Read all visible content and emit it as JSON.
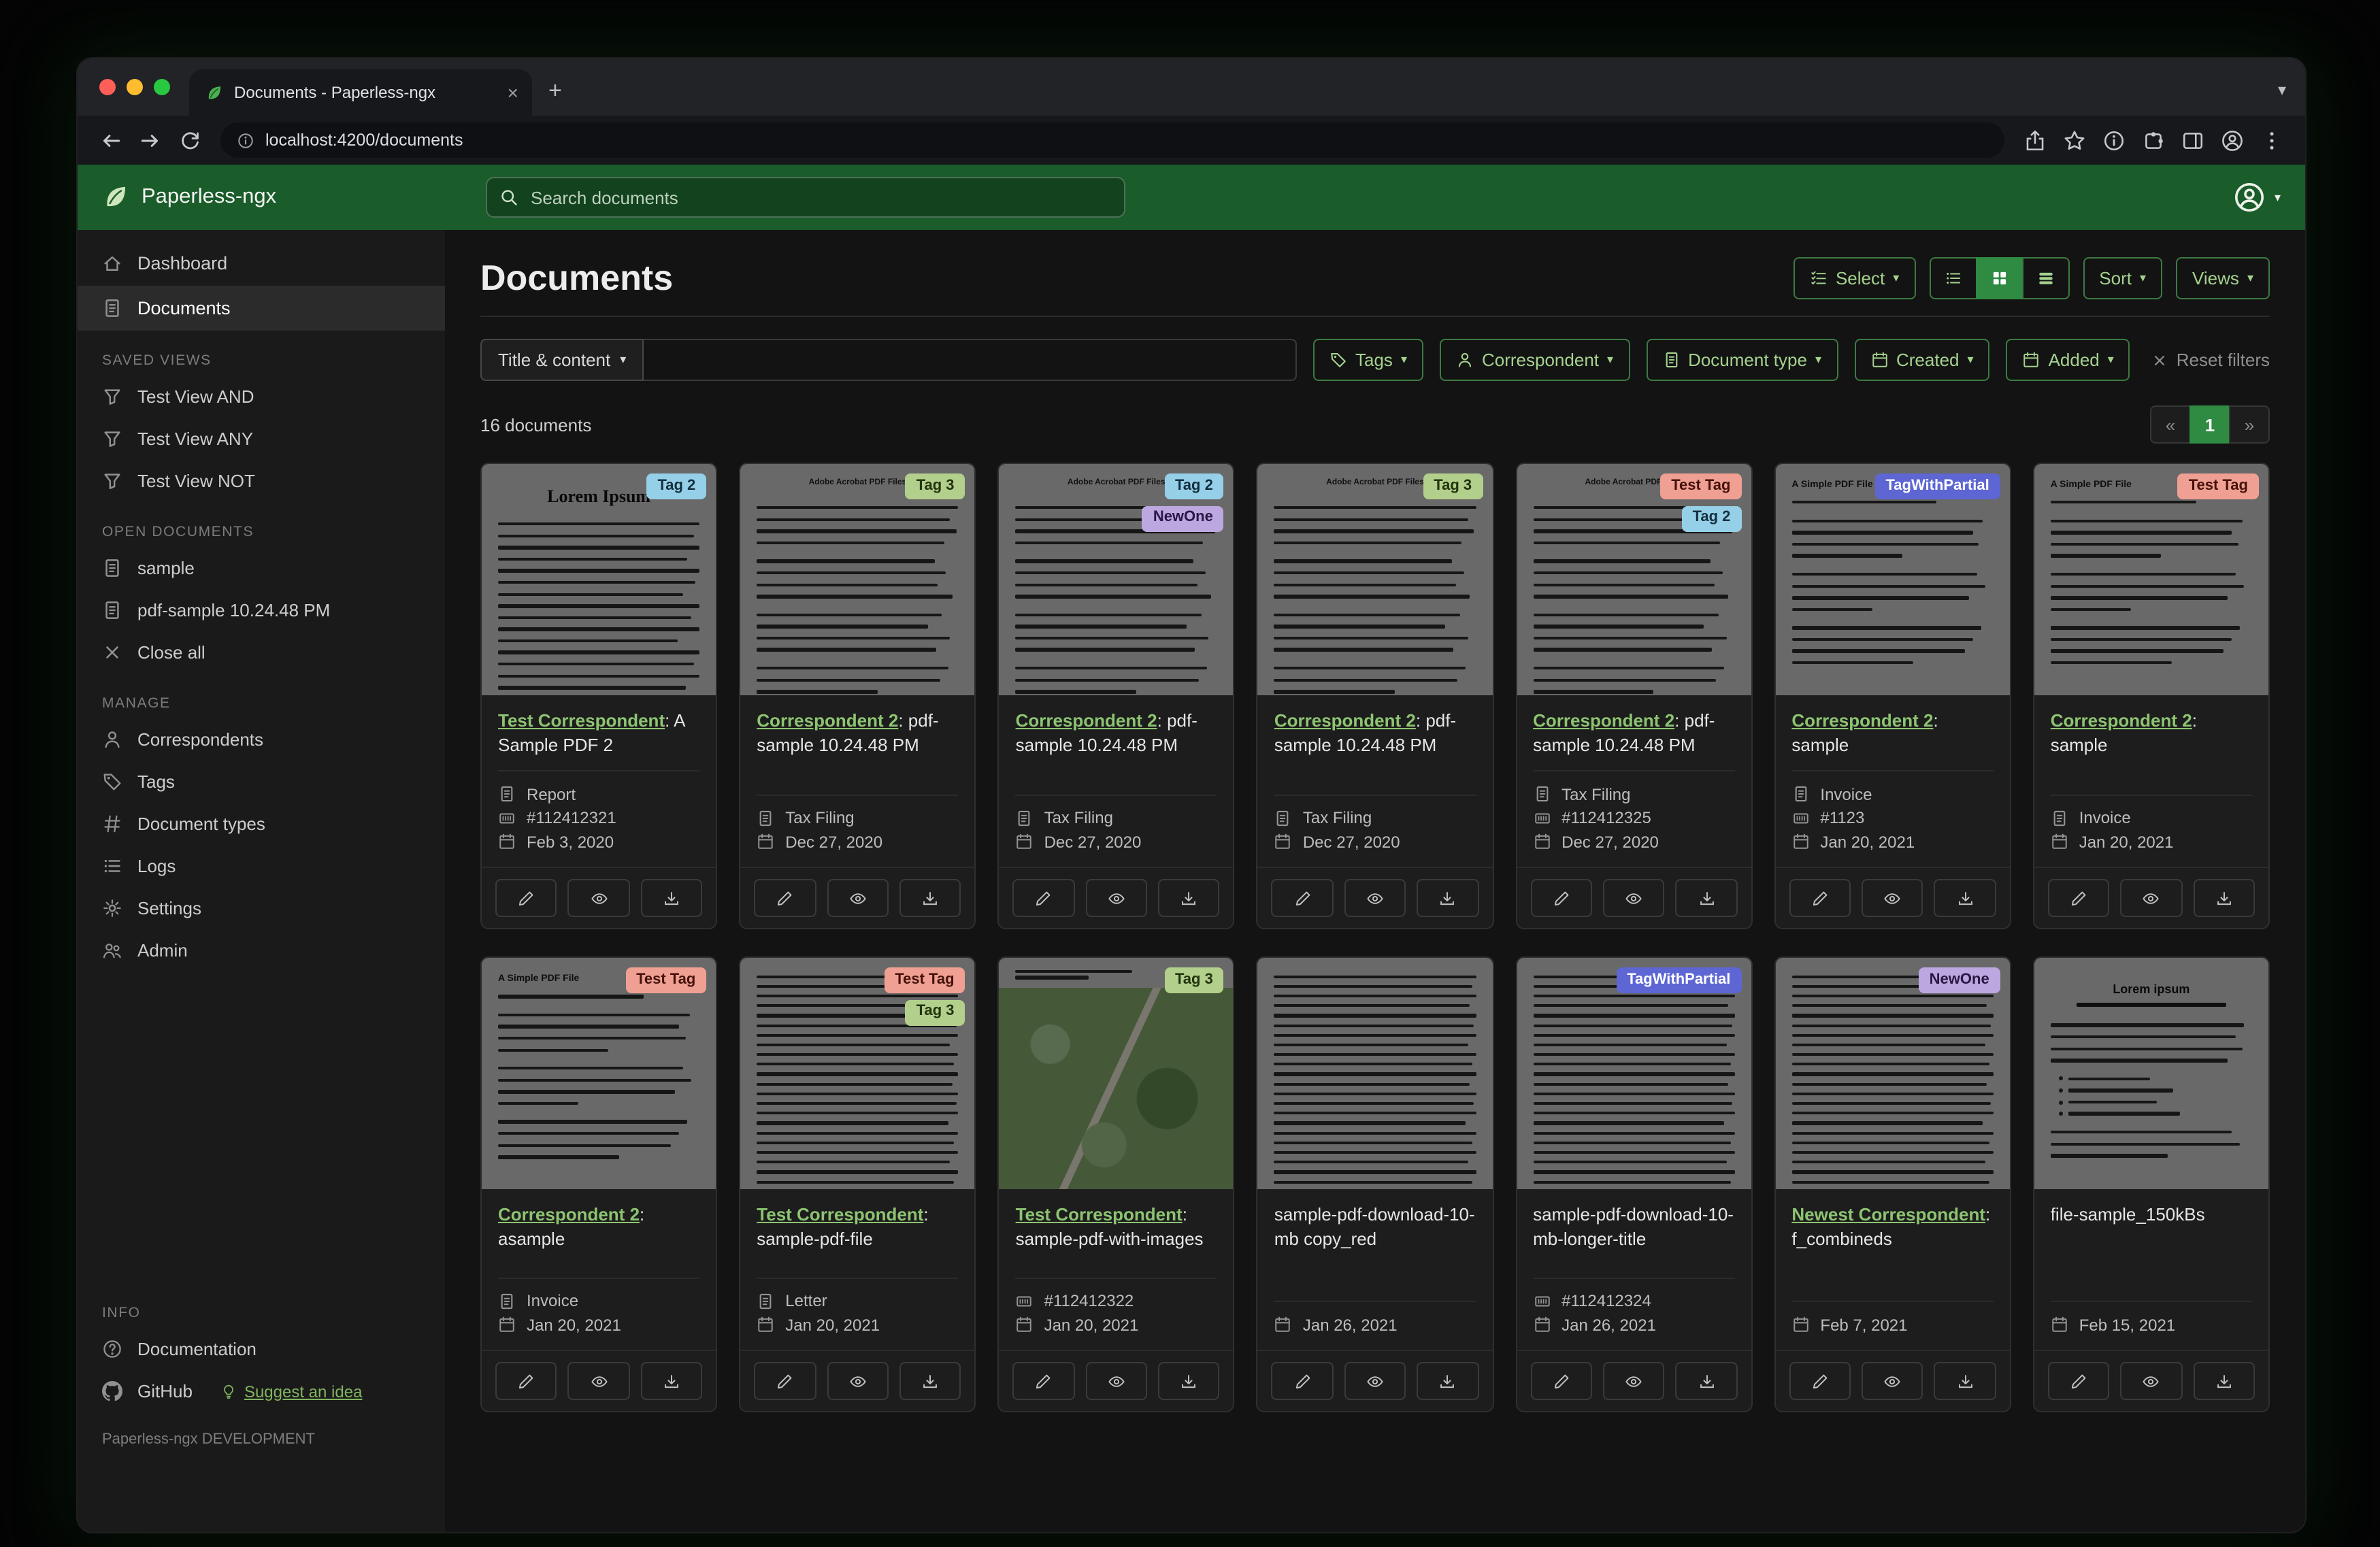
{
  "browser": {
    "tab_title": "Documents - Paperless-ngx",
    "new_tab_label": "+",
    "url": "localhost:4200/documents"
  },
  "header": {
    "brand": "Paperless-ngx",
    "search_placeholder": "Search documents"
  },
  "sidebar": {
    "primary": [
      {
        "label": "Dashboard",
        "icon": "home",
        "active": false
      },
      {
        "label": "Documents",
        "icon": "file",
        "active": true
      }
    ],
    "sections": [
      {
        "title": "SAVED VIEWS",
        "items": [
          {
            "label": "Test View AND",
            "icon": "funnel"
          },
          {
            "label": "Test View ANY",
            "icon": "funnel"
          },
          {
            "label": "Test View NOT",
            "icon": "funnel"
          }
        ]
      },
      {
        "title": "OPEN DOCUMENTS",
        "items": [
          {
            "label": "sample",
            "icon": "file"
          },
          {
            "label": "pdf-sample 10.24.48 PM",
            "icon": "file"
          },
          {
            "label": "Close all",
            "icon": "x"
          }
        ]
      },
      {
        "title": "MANAGE",
        "items": [
          {
            "label": "Correspondents",
            "icon": "person"
          },
          {
            "label": "Tags",
            "icon": "tag"
          },
          {
            "label": "Document types",
            "icon": "hash"
          },
          {
            "label": "Logs",
            "icon": "list"
          },
          {
            "label": "Settings",
            "icon": "gear"
          },
          {
            "label": "Admin",
            "icon": "people"
          }
        ]
      },
      {
        "title": "INFO",
        "items": [
          {
            "label": "Documentation",
            "icon": "question"
          },
          {
            "label": "GitHub",
            "icon": "github",
            "extra": "Suggest an idea"
          }
        ]
      }
    ],
    "footer": "Paperless-ngx DEVELOPMENT"
  },
  "main": {
    "title": "Documents",
    "select_label": "Select",
    "sort_label": "Sort",
    "views_label": "Views",
    "count_text": "16 documents",
    "pagination": {
      "prev": "«",
      "page": "1",
      "next": "»"
    }
  },
  "filters": {
    "title_dropdown": "Title & content",
    "tags_label": "Tags",
    "correspondent_label": "Correspondent",
    "doctype_label": "Document type",
    "created_label": "Created",
    "added_label": "Added",
    "reset_label": "Reset filters"
  },
  "cards": {
    "separator": ": ",
    "actions": [
      {
        "name": "edit",
        "icon": "pencil"
      },
      {
        "name": "preview",
        "icon": "eye"
      },
      {
        "name": "download",
        "icon": "download"
      }
    ]
  },
  "tags": {
    "Tag 2": {
      "bg": "#96cfe8",
      "fg": "#14303f"
    },
    "Tag 3": {
      "bg": "#b2cf8b",
      "fg": "#23330f"
    },
    "NewOne": {
      "bg": "#bda7e0",
      "fg": "#2a1844"
    },
    "Test Tag": {
      "bg": "#efa093",
      "fg": "#45120b"
    },
    "TagWithPartial": {
      "bg": "#5d66d3",
      "fg": "#ffffff"
    }
  },
  "documents": [
    {
      "correspondent": "Test Correspondent",
      "title": "A Sample PDF 2",
      "doc_type": "Report",
      "asn": "#112412321",
      "date": "Feb 3, 2020",
      "tags": [
        "Tag 2"
      ],
      "thumb": "lorem",
      "thumb_heading": "Lorem Ipsum"
    },
    {
      "correspondent": "Correspondent 2",
      "title": "pdf-sample 10.24.48 PM",
      "doc_type": "Tax Filing",
      "asn": null,
      "date": "Dec 27, 2020",
      "tags": [
        "Tag 3"
      ],
      "thumb": "acro",
      "thumb_heading": "Adobe Acrobat PDF Files"
    },
    {
      "correspondent": "Correspondent 2",
      "title": "pdf-sample 10.24.48 PM",
      "doc_type": "Tax Filing",
      "asn": null,
      "date": "Dec 27, 2020",
      "tags": [
        "Tag 2",
        "NewOne"
      ],
      "thumb": "acro",
      "thumb_heading": "Adobe Acrobat PDF Files"
    },
    {
      "correspondent": "Correspondent 2",
      "title": "pdf-sample 10.24.48 PM",
      "doc_type": "Tax Filing",
      "asn": null,
      "date": "Dec 27, 2020",
      "tags": [
        "Tag 3"
      ],
      "thumb": "acro",
      "thumb_heading": "Adobe Acrobat PDF Files"
    },
    {
      "correspondent": "Correspondent 2",
      "title": "pdf-sample 10.24.48 PM",
      "doc_type": "Tax Filing",
      "asn": "#112412325",
      "date": "Dec 27, 2020",
      "tags": [
        "Test Tag",
        "Tag 2"
      ],
      "thumb": "acro",
      "thumb_heading": "Adobe Acrobat PDF Files"
    },
    {
      "correspondent": "Correspondent 2",
      "title": "sample",
      "doc_type": "Invoice",
      "asn": "#1123",
      "date": "Jan 20, 2021",
      "tags": [
        "TagWithPartial"
      ],
      "thumb": "simple",
      "thumb_heading": "A Simple PDF File"
    },
    {
      "correspondent": "Correspondent 2",
      "title": "sample",
      "doc_type": "Invoice",
      "asn": null,
      "date": "Jan 20, 2021",
      "tags": [
        "Test Tag"
      ],
      "thumb": "simple",
      "thumb_heading": "A Simple PDF File"
    },
    {
      "correspondent": "Correspondent 2",
      "title": "asample",
      "doc_type": "Invoice",
      "asn": null,
      "date": "Jan 20, 2021",
      "tags": [
        "Test Tag"
      ],
      "thumb": "simple",
      "thumb_heading": "A Simple PDF File"
    },
    {
      "correspondent": "Test Correspondent",
      "title": "sample-pdf-file",
      "doc_type": "Letter",
      "asn": null,
      "date": "Jan 20, 2021",
      "tags": [
        "Test Tag",
        "Tag 3"
      ],
      "thumb": "dense",
      "thumb_heading": ""
    },
    {
      "correspondent": "Test Correspondent",
      "title": "sample-pdf-with-images",
      "doc_type": null,
      "asn": "#112412322",
      "date": "Jan 20, 2021",
      "tags": [
        "Tag 3"
      ],
      "thumb": "map",
      "thumb_heading": ""
    },
    {
      "correspondent": null,
      "title": "sample-pdf-download-10-mb copy_red",
      "doc_type": null,
      "asn": null,
      "date": "Jan 26, 2021",
      "tags": [],
      "thumb": "dense",
      "thumb_heading": ""
    },
    {
      "correspondent": null,
      "title": "sample-pdf-download-10-mb-longer-title",
      "doc_type": null,
      "asn": "#112412324",
      "date": "Jan 26, 2021",
      "tags": [
        "TagWithPartial"
      ],
      "thumb": "dense",
      "thumb_heading": ""
    },
    {
      "correspondent": "Newest Correspondent",
      "title": "f_combineds",
      "doc_type": null,
      "asn": null,
      "date": "Feb 7, 2021",
      "tags": [
        "NewOne"
      ],
      "thumb": "dense",
      "thumb_heading": ""
    },
    {
      "correspondent": null,
      "title": "file-sample_150kBs",
      "doc_type": null,
      "asn": null,
      "date": "Feb 15, 2021",
      "tags": [],
      "thumb": "sample150",
      "thumb_heading": "Lorem ipsum"
    }
  ]
}
